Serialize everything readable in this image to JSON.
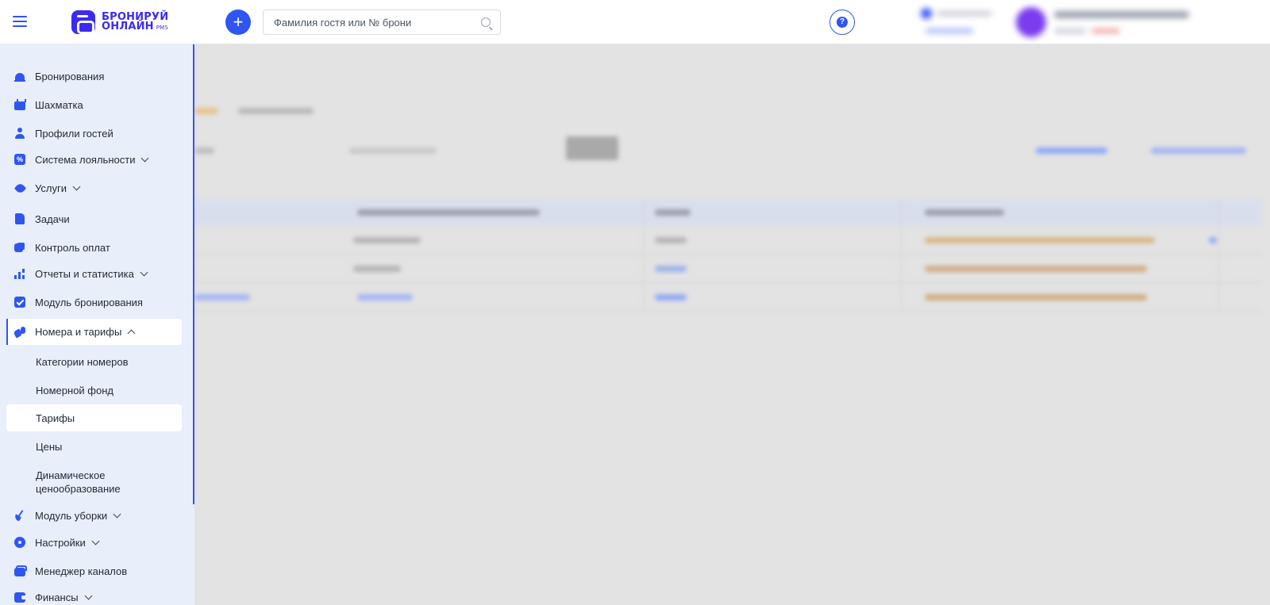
{
  "header": {
    "logo_line1": "БРОНИРУЙ",
    "logo_line2": "ОНЛАЙН",
    "logo_suffix": "PMS",
    "add_label": "+",
    "search": {
      "placeholder": "Фамилия гостя или № брони",
      "value": ""
    },
    "help_label": "?"
  },
  "sidebar": {
    "items": [
      {
        "label": "Бронирования",
        "icon": "bell-icon"
      },
      {
        "label": "Шахматка",
        "icon": "calendar-icon"
      },
      {
        "label": "Профили гостей",
        "icon": "user-icon"
      },
      {
        "label": "Система лояльности",
        "icon": "percent-icon",
        "expandable": true
      },
      {
        "label": "Услуги",
        "icon": "tag-icon",
        "expandable": true
      },
      {
        "label": "Задачи",
        "icon": "document-icon"
      },
      {
        "label": "Контроль оплат",
        "icon": "coins-icon"
      },
      {
        "label": "Отчеты и статистика",
        "icon": "bar-chart-icon",
        "expandable": true
      },
      {
        "label": "Модуль бронирования",
        "icon": "check-square-icon"
      },
      {
        "label": "Номера и тарифы",
        "icon": "key-icon",
        "expandable": true,
        "expanded": true,
        "active": true
      }
    ],
    "subitems": [
      {
        "label": "Категории номеров"
      },
      {
        "label": "Номерной фонд"
      },
      {
        "label": "Тарифы",
        "selected": true
      },
      {
        "label": "Цены"
      },
      {
        "label_line1": "Динамическое",
        "label_line2": "ценообразование"
      }
    ],
    "items_after": [
      {
        "label": "Модуль уборки",
        "icon": "broom-icon",
        "expandable": true
      },
      {
        "label": "Настройки",
        "icon": "gear-icon",
        "expandable": true
      },
      {
        "label": "Менеджер каналов",
        "icon": "channel-box-icon"
      },
      {
        "label": "Финансы",
        "icon": "wallet-icon",
        "expandable": true
      }
    ]
  },
  "colors": {
    "accent": "#2f55f3",
    "logo": "#3b2bf0",
    "sidebar_bg": "#e9eefb",
    "overlay_bg": "#e3e3e3"
  }
}
